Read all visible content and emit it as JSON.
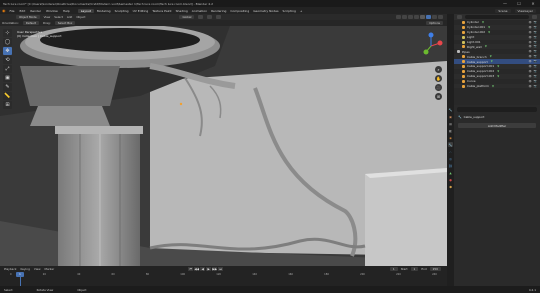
{
  "window": {
    "title": "Tech lure room* [C:\\Users\\Sonderer\\OneDrive\\Documents\\Vrstd\\Modern void\\Semester 1\\Tech lure room\\Tech lure room.blend] - Blender 4.2",
    "btn_min": "—",
    "btn_max": "☐",
    "btn_close": "✕"
  },
  "menubar": {
    "logo": "◉",
    "menus": [
      "File",
      "Edit",
      "Render",
      "Window",
      "Help"
    ],
    "workspaces": [
      "Layout",
      "Modeling",
      "Sculpting",
      "UV Editing",
      "Texture Paint",
      "Shading",
      "Animation",
      "Rendering",
      "Compositing",
      "Geometry Nodes",
      "Scripting",
      "+"
    ],
    "active_workspace": "Layout",
    "scene_label": "Scene",
    "view_layer_label": "ViewLayer"
  },
  "viewport_header": {
    "mode": "Object Mode",
    "menus": [
      "View",
      "Select",
      "Add",
      "Object"
    ],
    "orientation": "Global"
  },
  "tool_settings": {
    "orientation_label": "Orientation:",
    "orientation_value": "Default",
    "drag_label": "Drag:",
    "drag_value": "Select Box",
    "options": "Options"
  },
  "viewport": {
    "overlay_line1": "User Perspective",
    "overlay_line2": "(0) Collection | Cable_support",
    "tools": [
      "⊹",
      "◯",
      "✥",
      "⟲",
      "⤢",
      "▣",
      "✎",
      "📏",
      "⊞"
    ],
    "active_tool_index": 2,
    "nav": [
      "⌕",
      "✋",
      "🎥",
      "⊞"
    ],
    "gizmo": {
      "x_color": "#e8464b",
      "y_color": "#6cba2f",
      "z_color": "#3f7fe8"
    }
  },
  "timeline": {
    "menus": [
      "Playback",
      "Keying",
      "View",
      "Marker"
    ],
    "transport": [
      "⏮",
      "◀◀",
      "◀",
      "▶",
      "▶▶",
      "⏭"
    ],
    "current_frame": "1",
    "start_label": "Start",
    "start": "1",
    "end_label": "End",
    "end": "250",
    "ruler": [
      "0",
      "20",
      "40",
      "60",
      "80",
      "100",
      "120",
      "140",
      "160",
      "180",
      "200",
      "220",
      "240"
    ]
  },
  "statusbar": {
    "items": [
      "Select",
      "Rotate View",
      "Object"
    ],
    "version": "4.2.1"
  },
  "outliner": {
    "search_placeholder": "",
    "rows": [
      {
        "label": "Cylinder",
        "indent": 1,
        "icon_color": "#e8a33d",
        "modifier": true
      },
      {
        "label": "Cylinder.001",
        "indent": 1,
        "icon_color": "#e8a33d",
        "modifier": true
      },
      {
        "label": "Cylinder.002",
        "indent": 1,
        "icon_color": "#e8a33d",
        "modifier": true
      },
      {
        "label": "Light",
        "indent": 1,
        "icon_color": "#d0c05a",
        "modifier": false
      },
      {
        "label": "Light.001",
        "indent": 1,
        "icon_color": "#d0c05a",
        "modifier": false
      },
      {
        "label": "Right_wall",
        "indent": 1,
        "icon_color": "#e8a33d",
        "modifier": true
      },
      {
        "label": "Pipes",
        "indent": 0,
        "icon_color": "#bbbbbb",
        "modifier": false
      },
      {
        "label": "Cable_branch",
        "indent": 1,
        "icon_color": "#e8a33d",
        "modifier": true
      },
      {
        "label": "Cable_support",
        "indent": 1,
        "icon_color": "#e8a33d",
        "modifier": true
      },
      {
        "label": "Cable_support.001",
        "indent": 1,
        "icon_color": "#e8a33d",
        "modifier": true
      },
      {
        "label": "Cable_support.002",
        "indent": 1,
        "icon_color": "#e8a33d",
        "modifier": true
      },
      {
        "label": "Cable_support.003",
        "indent": 1,
        "icon_color": "#e8a33d",
        "modifier": true
      },
      {
        "label": "Curve",
        "indent": 1,
        "icon_color": "#e8a33d",
        "modifier": false
      },
      {
        "label": "Cable_platform",
        "indent": 1,
        "icon_color": "#e8a33d",
        "modifier": true
      }
    ],
    "selected_index": 8
  },
  "properties": {
    "object_name": "Cable_support",
    "add_modifier": "Add Modifier",
    "tabs": [
      {
        "icon": "🔧",
        "color": "#9a9a9a"
      },
      {
        "icon": "▣",
        "color": "#c4865a"
      },
      {
        "icon": "▦",
        "color": "#8a8a8a"
      },
      {
        "icon": "◧",
        "color": "#b4b4b4"
      },
      {
        "icon": "◉",
        "color": "#c9823a"
      },
      {
        "icon": "🔧",
        "color": "#4d8ed8"
      },
      {
        "icon": "∴",
        "color": "#5ba0d8"
      },
      {
        "icon": "◎",
        "color": "#5a9ad0"
      },
      {
        "icon": "⛓",
        "color": "#5a9ad0"
      },
      {
        "icon": "▲",
        "color": "#6ec36e"
      },
      {
        "icon": "●",
        "color": "#d04a4a"
      },
      {
        "icon": "⬢",
        "color": "#d0a04a"
      }
    ],
    "active_tab_index": 5
  }
}
